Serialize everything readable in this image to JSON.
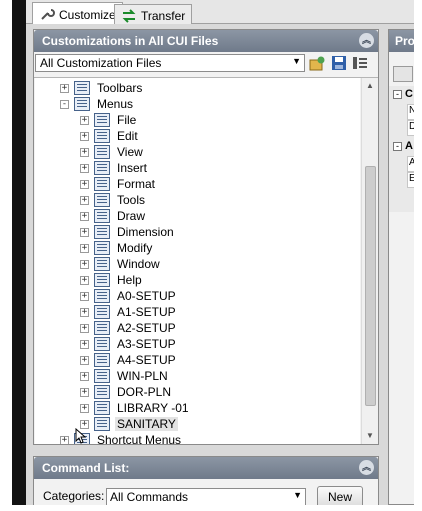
{
  "tabs": [
    {
      "label": "Customize",
      "icon": "wrench-icon",
      "active": true
    },
    {
      "label": "Transfer",
      "icon": "transfer-arrows-icon",
      "active": false
    }
  ],
  "cui_panel": {
    "title": "Customizations in All CUI Files",
    "collapse_glyph": "︽",
    "file_filter": "All Customization Files",
    "toolbar_icons": [
      "load-partial-icon",
      "save-icon",
      "display-filters-icon"
    ],
    "tree": {
      "toolbars_label": "Toolbars",
      "menus_label": "Menus",
      "menus": [
        "File",
        "Edit",
        "View",
        "Insert",
        "Format",
        "Tools",
        "Draw",
        "Dimension",
        "Modify",
        "Window",
        "Help",
        "A0-SETUP",
        "A1-SETUP",
        "A2-SETUP",
        "A3-SETUP",
        "A4-SETUP",
        "WIN-PLN",
        "DOR-PLN",
        "LIBRARY -01",
        "SANITARY"
      ],
      "selected": "SANITARY",
      "shortcut_menus_label": "Shortcut Menus"
    }
  },
  "command_panel": {
    "title": "Command List:",
    "collapse_glyph": "︽",
    "categories_label": "Categories:",
    "categories_value": "All Commands",
    "new_button": "New"
  },
  "properties_panel": {
    "title_fragment": "Pro",
    "rows": [
      {
        "cat": "C",
        "cells": [
          "N",
          "D"
        ]
      },
      {
        "cat": "A",
        "cells": [
          "A",
          "E"
        ]
      }
    ]
  }
}
